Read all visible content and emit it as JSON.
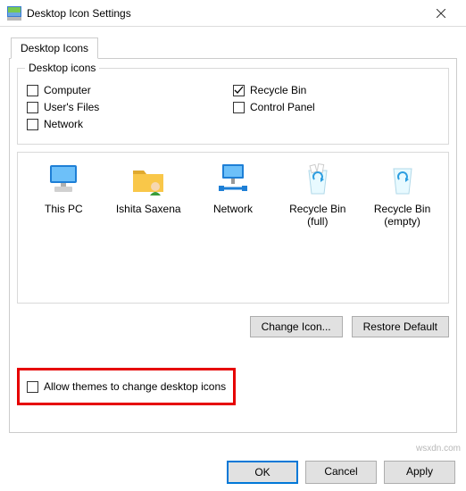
{
  "titlebar": {
    "title": "Desktop Icon Settings"
  },
  "tabs": {
    "desktop_icons": "Desktop Icons"
  },
  "groupbox": {
    "legend": "Desktop icons",
    "items": {
      "computer": "Computer",
      "users_files": "User's Files",
      "network": "Network",
      "recycle_bin": "Recycle Bin",
      "control_panel": "Control Panel"
    }
  },
  "icon_list": {
    "items": {
      "this_pc": "This PC",
      "user": "Ishita Saxena",
      "network": "Network",
      "recycle_full": "Recycle Bin (full)",
      "recycle_empty": "Recycle Bin (empty)"
    }
  },
  "buttons": {
    "change_icon": "Change Icon...",
    "restore_default": "Restore Default",
    "ok": "OK",
    "cancel": "Cancel",
    "apply": "Apply"
  },
  "allow_themes": {
    "label": "Allow themes to change desktop icons"
  },
  "watermark": "wsxdn.com"
}
